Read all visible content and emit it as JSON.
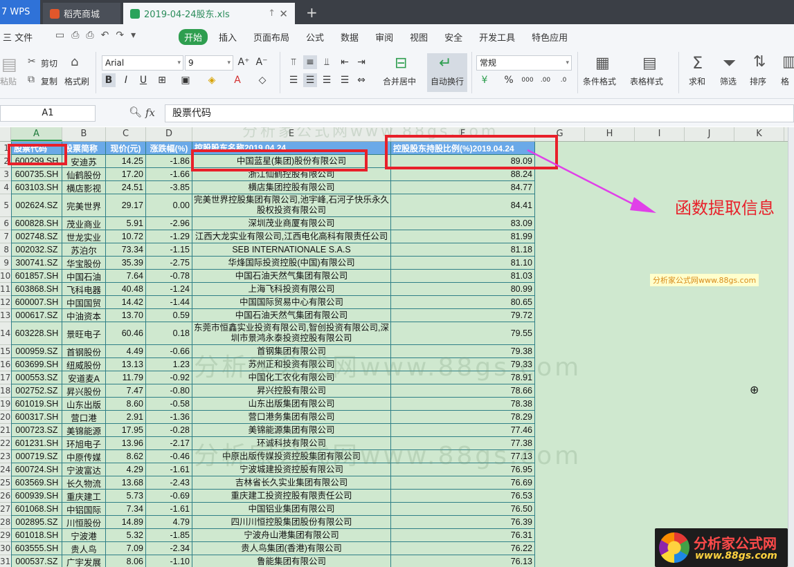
{
  "titlebar": {
    "tabs": [
      "7 WPS",
      "稻壳商城",
      "2019-04-24股东.xls"
    ],
    "new_tab_icon": "plus-icon"
  },
  "menu": {
    "file": "三 文件",
    "start": "开始",
    "items": [
      "插入",
      "页面布局",
      "公式",
      "数据",
      "审阅",
      "视图",
      "安全",
      "开发工具",
      "特色应用"
    ]
  },
  "ribbon": {
    "paste": "粘贴",
    "cut": "剪切",
    "copy": "复制",
    "format_painter": "格式刷",
    "font_name": "Arial",
    "font_size": "9",
    "merge_center": "合并居中",
    "auto_wrap": "自动换行",
    "number_format": "常规",
    "conditional_format": "条件格式",
    "table_style": "表格样式",
    "sum": "求和",
    "filter": "筛选",
    "sort": "排序",
    "format_more": "格"
  },
  "formula_bar": {
    "cell_ref": "A1",
    "fx": "fx",
    "content": "股票代码"
  },
  "columns": [
    "A",
    "B",
    "C",
    "D",
    "E",
    "F",
    "G",
    "H",
    "I",
    "J",
    "K"
  ],
  "row_numbers": [
    "1",
    "2",
    "3",
    "4",
    "5",
    "6",
    "7",
    "8",
    "9",
    "10",
    "11",
    "12",
    "13",
    "14",
    "15",
    "16",
    "17",
    "18",
    "19",
    "20",
    "21",
    "22",
    "23",
    "24",
    "25",
    "26",
    "27",
    "28",
    "29",
    "30",
    "31"
  ],
  "table": {
    "headers": [
      "股票代码",
      "股票简称",
      "现价(元)",
      "涨跌幅(%)",
      "控股股东名称2019.04.24",
      "控股股东持股比例(%)2019.04.24"
    ],
    "rows": [
      [
        "600299.SH",
        "安迪苏",
        "14.25",
        "-1.86",
        "中国蓝星(集团)股份有限公司",
        "89.09"
      ],
      [
        "600735.SH",
        "仙鹤股份",
        "17.20",
        "-1.66",
        "浙江仙鹤控股有限公司",
        "88.24"
      ],
      [
        "603103.SH",
        "横店影视",
        "24.51",
        "-3.85",
        "横店集团控股有限公司",
        "84.77"
      ],
      [
        "002624.SZ",
        "完美世界",
        "29.17",
        "0.00",
        "完美世界控股集团有限公司,池宇峰,石河子快乐永久股权投资有限公司",
        "84.41"
      ],
      [
        "600828.SH",
        "茂业商业",
        "5.91",
        "-2.96",
        "深圳茂业商厦有限公司",
        "83.09"
      ],
      [
        "002748.SZ",
        "世龙实业",
        "10.72",
        "-1.29",
        "江西大龙实业有限公司,江西电化高科有限责任公司",
        "81.99"
      ],
      [
        "002032.SZ",
        "苏泊尔",
        "73.34",
        "-1.15",
        "SEB INTERNATIONALE S.A.S",
        "81.18"
      ],
      [
        "300741.SZ",
        "华宝股份",
        "35.39",
        "-2.75",
        "华烽国际投资控股(中国)有限公司",
        "81.10"
      ],
      [
        "601857.SH",
        "中国石油",
        "7.64",
        "-0.78",
        "中国石油天然气集团有限公司",
        "81.03"
      ],
      [
        "603868.SH",
        "飞科电器",
        "40.48",
        "-1.24",
        "上海飞科投资有限公司",
        "80.99"
      ],
      [
        "600007.SH",
        "中国国贸",
        "14.42",
        "-1.44",
        "中国国际贸易中心有限公司",
        "80.65"
      ],
      [
        "000617.SZ",
        "中油资本",
        "13.70",
        "0.59",
        "中国石油天然气集团有限公司",
        "79.72"
      ],
      [
        "603228.SH",
        "景旺电子",
        "60.46",
        "0.18",
        "东莞市恒鑫实业投资有限公司,智创投资有限公司,深圳市景鸿永泰投资控股有限公司",
        "79.55"
      ],
      [
        "000959.SZ",
        "首钢股份",
        "4.49",
        "-0.66",
        "首钢集团有限公司",
        "79.38"
      ],
      [
        "603699.SH",
        "纽威股份",
        "13.13",
        "1.23",
        "苏州正和投资有限公司",
        "79.33"
      ],
      [
        "000553.SZ",
        "安道麦A",
        "11.79",
        "-0.92",
        "中国化工农化有限公司",
        "78.91"
      ],
      [
        "002752.SZ",
        "昇兴股份",
        "7.47",
        "-0.80",
        "昇兴控股有限公司",
        "78.66"
      ],
      [
        "601019.SH",
        "山东出版",
        "8.60",
        "-0.58",
        "山东出版集团有限公司",
        "78.38"
      ],
      [
        "600317.SH",
        "营口港",
        "2.91",
        "-1.36",
        "营口港务集团有限公司",
        "78.29"
      ],
      [
        "000723.SZ",
        "美锦能源",
        "17.95",
        "-0.28",
        "美锦能源集团有限公司",
        "77.46"
      ],
      [
        "601231.SH",
        "环旭电子",
        "13.96",
        "-2.17",
        "环诚科技有限公司",
        "77.38"
      ],
      [
        "000719.SZ",
        "中原传媒",
        "8.62",
        "-0.46",
        "中原出版传媒投资控股集团有限公司",
        "77.13"
      ],
      [
        "600724.SH",
        "宁波富达",
        "4.29",
        "-1.61",
        "宁波城建投资控股有限公司",
        "76.95"
      ],
      [
        "603569.SH",
        "长久物流",
        "13.68",
        "-2.43",
        "吉林省长久实业集团有限公司",
        "76.69"
      ],
      [
        "600939.SH",
        "重庆建工",
        "5.73",
        "-0.69",
        "重庆建工投资控股有限责任公司",
        "76.53"
      ],
      [
        "601068.SH",
        "中铝国际",
        "7.34",
        "-1.61",
        "中国铝业集团有限公司",
        "76.50"
      ],
      [
        "002895.SZ",
        "川恒股份",
        "14.89",
        "4.79",
        "四川川恒控股集团股份有限公司",
        "76.39"
      ],
      [
        "601018.SH",
        "宁波港",
        "5.32",
        "-1.85",
        "宁波舟山港集团有限公司",
        "76.31"
      ],
      [
        "603555.SH",
        "贵人鸟",
        "7.09",
        "-2.34",
        "贵人鸟集团(香港)有限公司",
        "76.22"
      ],
      [
        "000537.SZ",
        "广宇发展",
        "8.06",
        "-1.10",
        "鲁能集团有限公司",
        "76.13"
      ]
    ]
  },
  "annotation": {
    "label": "函数提取信息",
    "arrow_color": "#e040e8",
    "box_color": "#e8202a"
  },
  "watermarks": {
    "small": "分析家公式网www.88gs.com",
    "big": "分析家公式网www.88gs.com",
    "logo_title": "分析家公式网",
    "logo_url": "www.88gs.com"
  },
  "colors": {
    "sheet_bg": "#cfe8cf",
    "header_fill": "#6aa9e8",
    "accent_green": "#2e9e4f"
  }
}
